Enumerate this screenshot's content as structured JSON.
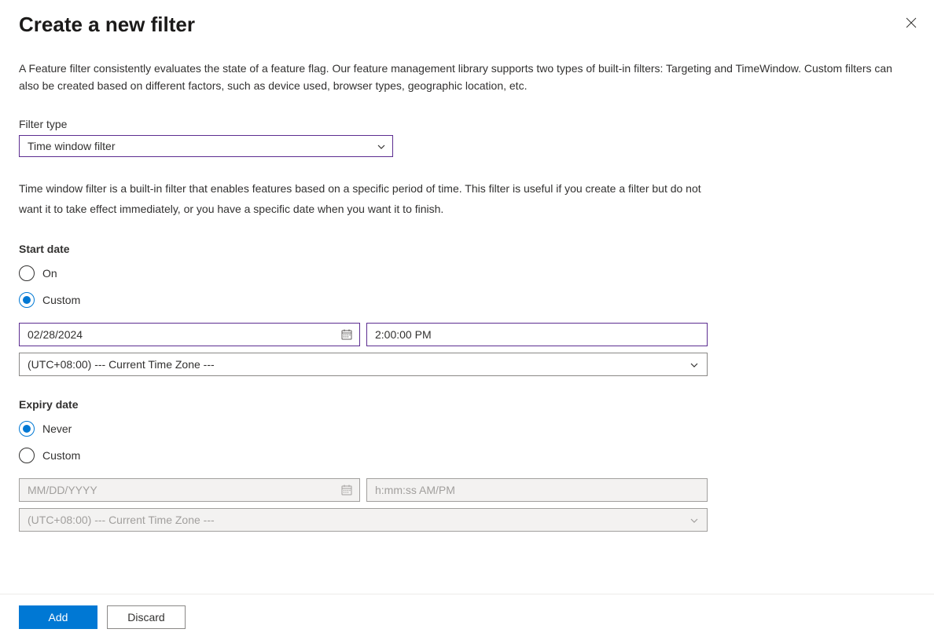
{
  "header": {
    "title": "Create a new filter"
  },
  "description": "A Feature filter consistently evaluates the state of a feature flag. Our feature management library supports two types of built-in filters: Targeting and TimeWindow. Custom filters can also be created based on different factors, such as device used, browser types, geographic location, etc.",
  "filter_type": {
    "label": "Filter type",
    "value": "Time window filter"
  },
  "filter_help": "Time window filter is a built-in filter that enables features based on a specific period of time. This filter is useful if you create a filter but do not want it to take effect immediately, or you have a specific date when you want it to finish.",
  "start_date": {
    "label": "Start date",
    "on_label": "On",
    "custom_label": "Custom",
    "date_value": "02/28/2024",
    "time_value": "2:00:00 PM",
    "tz_value": "(UTC+08:00) --- Current Time Zone ---"
  },
  "expiry_date": {
    "label": "Expiry date",
    "never_label": "Never",
    "custom_label": "Custom",
    "date_placeholder": "MM/DD/YYYY",
    "time_placeholder": "h:mm:ss AM/PM",
    "tz_value": "(UTC+08:00) --- Current Time Zone ---"
  },
  "footer": {
    "add_label": "Add",
    "discard_label": "Discard"
  }
}
